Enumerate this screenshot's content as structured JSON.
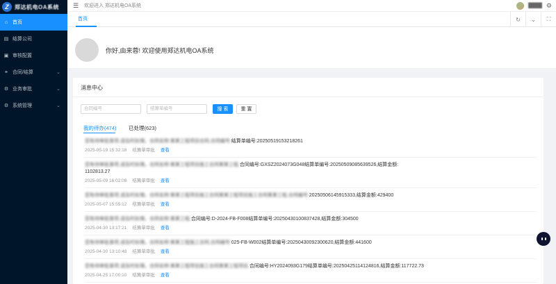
{
  "app": {
    "logo_letter": "Z",
    "logo_text": "郑达机电OA系统"
  },
  "sidebar": {
    "items": [
      {
        "label": "首页",
        "icon": "home-icon",
        "glyph": "⌂",
        "active": true,
        "has_children": false
      },
      {
        "label": "结算公司",
        "icon": "building-icon",
        "glyph": "▤",
        "active": false,
        "has_children": false
      },
      {
        "label": "审核配置",
        "icon": "audit-icon",
        "glyph": "▣",
        "active": false,
        "has_children": false
      },
      {
        "label": "合同/结算",
        "icon": "contract-icon",
        "glyph": "⚭",
        "active": false,
        "has_children": true
      },
      {
        "label": "业务审批",
        "icon": "approval-icon",
        "glyph": "⚙",
        "active": false,
        "has_children": true
      },
      {
        "label": "系统管理",
        "icon": "system-icon",
        "glyph": "⚙",
        "active": false,
        "has_children": true
      }
    ]
  },
  "topbar": {
    "welcome": "欢迎进入 郑达机电OA系统",
    "username": "████"
  },
  "tabs": {
    "home": "首页"
  },
  "hello": {
    "greeting": "你好,由来蓉! 欢迎使用郑达机电OA系统"
  },
  "messages": {
    "title": "消息中心",
    "contract_placeholder": "合同编号",
    "settlement_placeholder": "结算单编号",
    "search_label": "搜 索",
    "reset_label": "重 置",
    "tab_todo": "我的待办(474)",
    "tab_done": "已处理(623)",
    "items": [
      {
        "redacted": "您有待审批事项,请及时处理。合同名称:某某工程项目合同,合同编号:",
        "text": "结算单编号:20250519153218261",
        "date": "2025-05-19 15:32:18",
        "type": "结算单审批",
        "link": "查看"
      },
      {
        "redacted": "您有待审批事项,请及时处理。合同名称:某某工程项目施工合同某某工程,",
        "text": "合同编号:GXSZ2024073G048结算单编号:20250509085639526,结算金额:",
        "text2": "1102813.27",
        "date": "2025-05-09 16:02:08",
        "type": "结算单审批",
        "link": "查看"
      },
      {
        "redacted": "您有待审批事项,请及时处理。合同名称:某某工程项目施工合同某某工程项目施工合同某某工程,合同编号:",
        "text": "20250506145915333,结算金额:429400",
        "date": "2025-05-07 15:55:12",
        "type": "结算单审批",
        "link": "查看"
      },
      {
        "redacted": "您有待审批事项,请及时处理。合同名称:某某工程,",
        "text": "合同编号:",
        "text_mid": "D-2024-FB-F008结算单编号:20250430100837428,结算金额:304500",
        "date": "2025-04-30 13:17:21",
        "type": "结算单审批",
        "link": "查看"
      },
      {
        "redacted": "您有待审批事项,请及时处理。合同名称:某某工程施工合同,合同编号:",
        "text": "025-FB-W002结算单编号:20250430092300620,结算金额:441600",
        "date": "2025-04-30 13:10:48",
        "type": "结算单审批",
        "link": "查看"
      },
      {
        "redacted": "您有待审批事项,请及时处理。合同名称:某某工程项目施工合同某某工程项目,",
        "text": "合同编号:HY2024093G179结算单编号:20250425114124816,结算金额:117722.73",
        "date": "2025-04-25 17:00:10",
        "type": "结算单审批",
        "link": "查看"
      }
    ]
  },
  "colors": {
    "sidebar_bg": "#001529",
    "accent": "#1890ff"
  }
}
